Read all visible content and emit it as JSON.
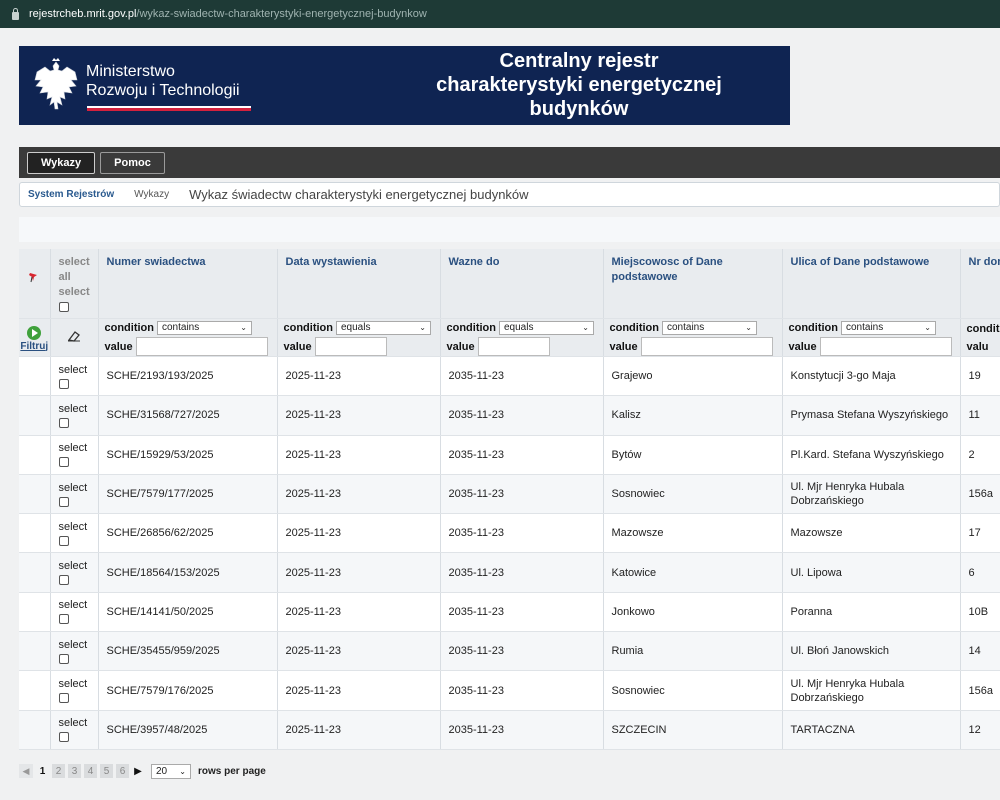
{
  "browser": {
    "url_host": "rejestrcheb.mrit.gov.pl",
    "url_path": "/wykaz-swiadectw-charakterystyki-energetycznej-budynkow"
  },
  "banner": {
    "ministry_line1": "Ministerstwo",
    "ministry_line2": "Rozwoju i Technologii",
    "title_line1": "Centralny rejestr",
    "title_line2": "charakterystyki energetycznej",
    "title_line3": "budynków",
    "colors": {
      "background": "#0f2452",
      "flag_red": "#d4213d"
    }
  },
  "toolbar": {
    "items": [
      {
        "label": "Wykazy",
        "active": true
      },
      {
        "label": "Pomoc",
        "active": false
      }
    ]
  },
  "breadcrumb": {
    "root": "System Rejestrów",
    "section": "Wykazy",
    "title": "Wykaz świadectw charakterystyki energetycznej budynków"
  },
  "table": {
    "select_header": {
      "line1": "select",
      "line2": "all",
      "line3": "select"
    },
    "columns": [
      "Numer swiadectwa",
      "Data wystawienia",
      "Wazne do",
      "Miejscowosc of Dane podstawowe",
      "Ulica of Dane podstawowe",
      "Nr dom"
    ],
    "filter": {
      "action_label": "Filtruj",
      "condition_label": "condition",
      "value_label": "value",
      "conditions": [
        "contains",
        "equals",
        "equals",
        "contains",
        "contains",
        ""
      ],
      "last_condition_label": "condit",
      "last_value_label": "valu"
    },
    "select_label": "select",
    "rows": [
      {
        "numer": "SCHE/2193/193/2025",
        "data": "2025-11-23",
        "wazne": "2035-11-23",
        "miejscowosc": "Grajewo",
        "ulica": "Konstytucji 3-go Maja",
        "ulica2": "",
        "nr": "19"
      },
      {
        "numer": "SCHE/31568/727/2025",
        "data": "2025-11-23",
        "wazne": "2035-11-23",
        "miejscowosc": "Kalisz",
        "ulica": "Prymasa Stefana Wyszyńskiego",
        "ulica2": "",
        "nr": "11"
      },
      {
        "numer": "SCHE/15929/53/2025",
        "data": "2025-11-23",
        "wazne": "2035-11-23",
        "miejscowosc": "Bytów",
        "ulica": "Pl.Kard. Stefana Wyszyńskiego",
        "ulica2": "",
        "nr": "2"
      },
      {
        "numer": "SCHE/7579/177/2025",
        "data": "2025-11-23",
        "wazne": "2035-11-23",
        "miejscowosc": "Sosnowiec",
        "ulica": "Ul. Mjr Henryka Hubala",
        "ulica2": "Dobrzańskiego",
        "nr": "156a"
      },
      {
        "numer": "SCHE/26856/62/2025",
        "data": "2025-11-23",
        "wazne": "2035-11-23",
        "miejscowosc": "Mazowsze",
        "ulica": "Mazowsze",
        "ulica2": "",
        "nr": "17"
      },
      {
        "numer": "SCHE/18564/153/2025",
        "data": "2025-11-23",
        "wazne": "2035-11-23",
        "miejscowosc": "Katowice",
        "ulica": "Ul. Lipowa",
        "ulica2": "",
        "nr": "6"
      },
      {
        "numer": "SCHE/14141/50/2025",
        "data": "2025-11-23",
        "wazne": "2035-11-23",
        "miejscowosc": "Jonkowo",
        "ulica": "Poranna",
        "ulica2": "",
        "nr": "10B"
      },
      {
        "numer": "SCHE/35455/959/2025",
        "data": "2025-11-23",
        "wazne": "2035-11-23",
        "miejscowosc": "Rumia",
        "ulica": "Ul. Błoń Janowskich",
        "ulica2": "",
        "nr": "14"
      },
      {
        "numer": "SCHE/7579/176/2025",
        "data": "2025-11-23",
        "wazne": "2035-11-23",
        "miejscowosc": "Sosnowiec",
        "ulica": "Ul. Mjr Henryka Hubala",
        "ulica2": "Dobrzańskiego",
        "nr": "156a"
      },
      {
        "numer": "SCHE/3957/48/2025",
        "data": "2025-11-23",
        "wazne": "2035-11-23",
        "miejscowosc": "SZCZECIN",
        "ulica": "TARTACZNA",
        "ulica2": "",
        "nr": "12"
      }
    ]
  },
  "pager": {
    "current_page": "1",
    "pages": [
      "2",
      "3",
      "4",
      "5",
      "6"
    ],
    "rows_per_page_value": "20",
    "rows_per_page_label": "rows per page"
  }
}
